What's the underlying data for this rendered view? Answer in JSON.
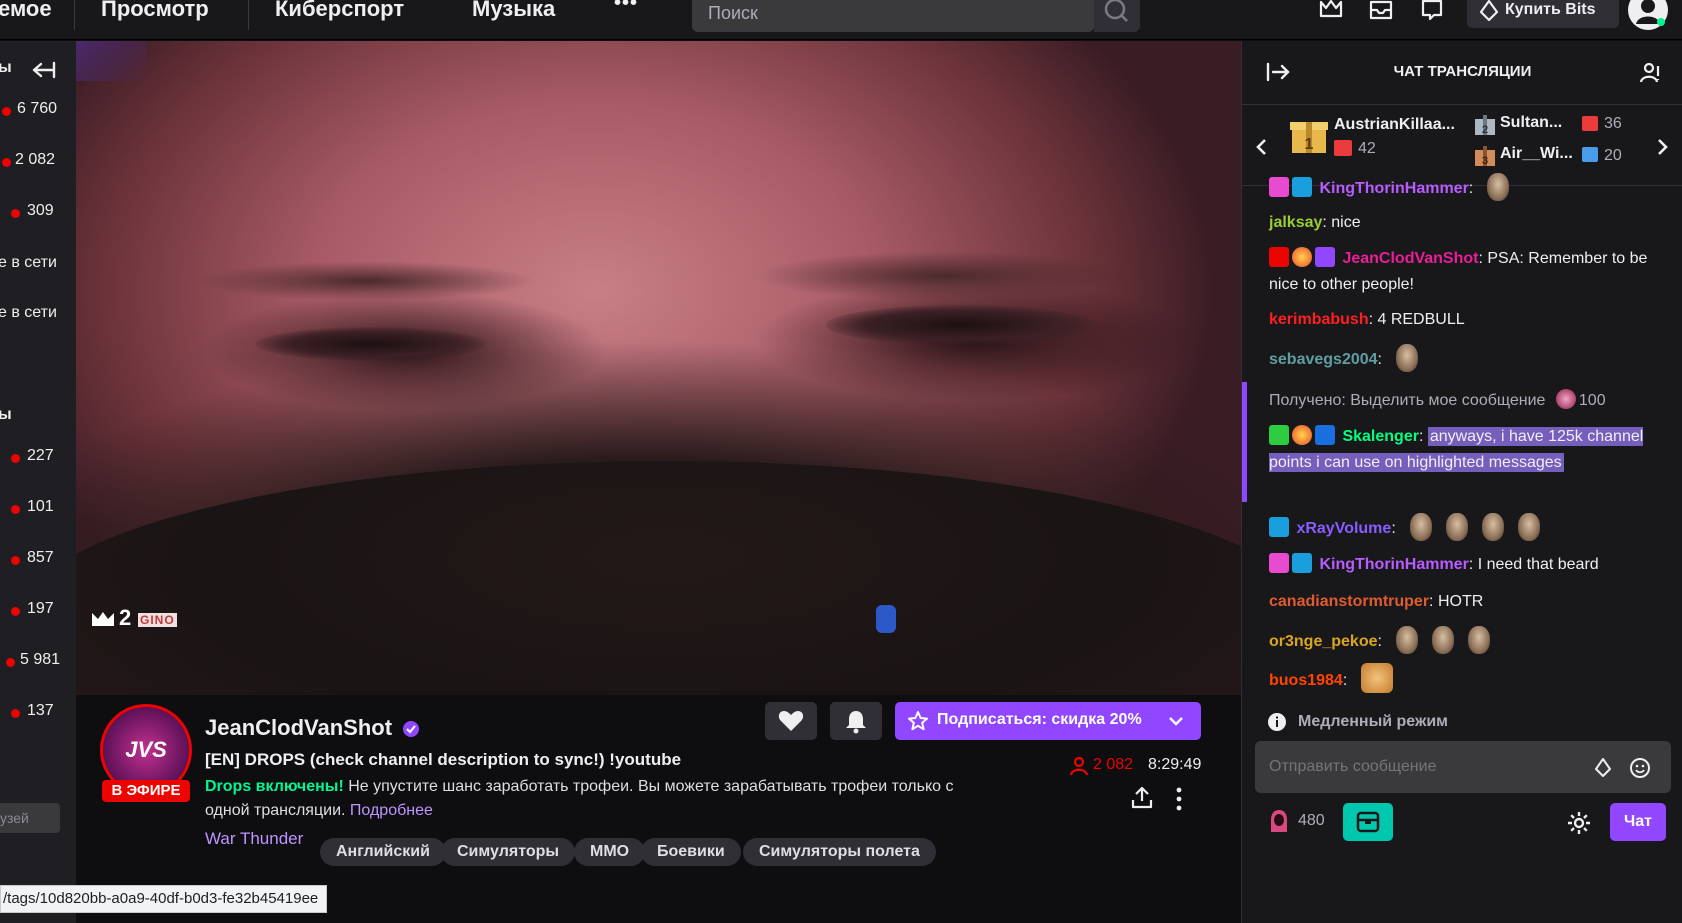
{
  "topnav": {
    "links": [
      "емое",
      "Просмотр",
      "Киберспорт",
      "Музыка"
    ],
    "more_label": "•••",
    "search_placeholder": "Поиск",
    "bits_label": "Купить Bits"
  },
  "sidebar": {
    "collapse_header": "ы",
    "items": [
      {
        "count": "6 760"
      },
      {
        "count": "2 082"
      },
      {
        "count": "309"
      },
      {
        "status": "е в сети"
      },
      {
        "status": "е в сети"
      }
    ],
    "section2_header": "ы",
    "items2": [
      {
        "count": "227"
      },
      {
        "count": "101"
      },
      {
        "count": "857"
      },
      {
        "count": "197"
      },
      {
        "count": "5 981"
      },
      {
        "count": "137"
      }
    ],
    "bottom_fragment": "узей"
  },
  "video": {
    "overlay_count": "2",
    "overlay_tag": "GINO"
  },
  "stream": {
    "live_badge": "В ЭФИРЕ",
    "channel_name": "JeanClodVanShot",
    "title": "[EN] DROPS (check channel description to sync!) !youtube",
    "drops_label": "Drops включены!",
    "drops_text": " Не упустите шанс заработать трофеи. Вы можете зарабатывать трофеи только с одной трансляции.",
    "drops_link": "Подробнее",
    "viewers": "2 082",
    "uptime": "8:29:49",
    "subscribe_label": "Подписаться: скидка 20%",
    "game": "War Thunder",
    "tags": [
      "Английский",
      "Симуляторы",
      "MMO",
      "Боевики",
      "Симуляторы полета"
    ],
    "status_url": "/tags/10d820bb-a0a9-40df-b0d3-fe32b45419ee"
  },
  "chat": {
    "header_title": "ЧАТ ТРАНСЛЯЦИИ",
    "leaderboard": {
      "first": {
        "name": "AustrianKillaa...",
        "gifts": "42"
      },
      "second": {
        "name": "Sultan...",
        "gifts": "36"
      },
      "third": {
        "name": "Air__Wi...",
        "gifts": "20"
      }
    },
    "messages": [
      {
        "user": "KingThorinHammer",
        "text": ""
      },
      {
        "user": "jalksay",
        "text": "nice"
      },
      {
        "user": "JeanClodVanShot",
        "text": "PSA: Remember to be nice to other people!"
      },
      {
        "user": "kerimbabush",
        "text": "4 REDBULL"
      },
      {
        "user": "sebavegs2004",
        "text": ""
      },
      {
        "user": "",
        "text": "Получено: Выделить мое сообщение",
        "points": "100"
      },
      {
        "user": "Skalenger",
        "text": "anyways, i have 125k channel points i can use on highlighted messages"
      },
      {
        "user": "xRayVolume",
        "text": ""
      },
      {
        "user": "KingThorinHammer",
        "text": "I need that beard"
      },
      {
        "user": "canadianstormtruper",
        "text": "HOTR"
      },
      {
        "user": "or3nge_pekoe",
        "text": ""
      },
      {
        "user": "buos1984",
        "text": ""
      }
    ],
    "slow_mode": "Медленный режим",
    "input_placeholder": "Отправить сообщение",
    "channel_points": "480",
    "send_label": "Чат"
  },
  "colors": {
    "accent": "#9147ff",
    "live": "#eb0400",
    "bg": "#0e0e10",
    "panel": "#18181b"
  }
}
